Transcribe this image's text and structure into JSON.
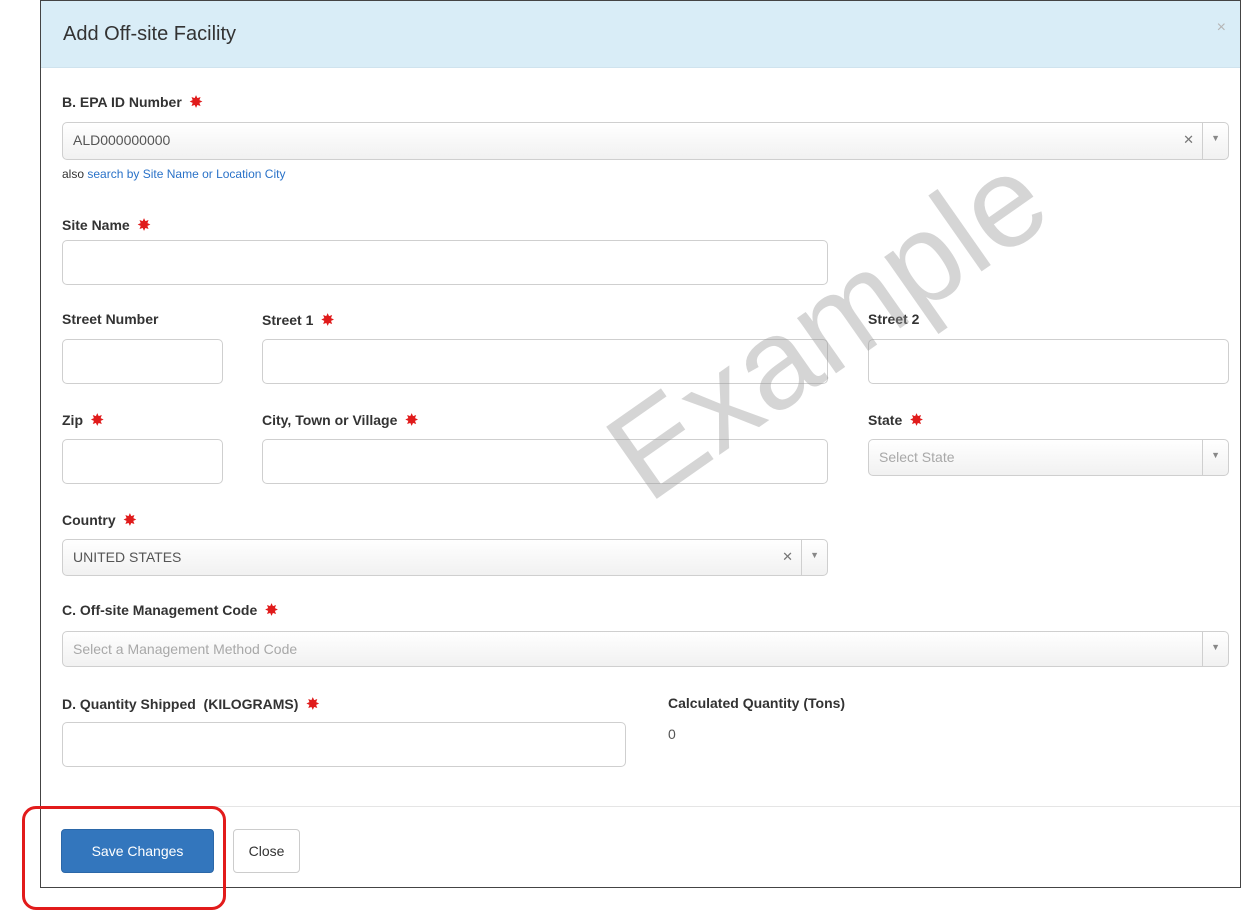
{
  "modal": {
    "title": "Add Off-site Facility",
    "close_glyph": "×"
  },
  "fields": {
    "epa_id": {
      "label": "B. EPA ID Number",
      "value": "ALD000000000",
      "helper_prefix": "also",
      "helper_link": "search by Site Name or Location City"
    },
    "site_name": {
      "label": "Site Name",
      "value": ""
    },
    "street_number": {
      "label": "Street Number",
      "value": ""
    },
    "street1": {
      "label": "Street 1",
      "value": ""
    },
    "street2": {
      "label": "Street 2",
      "value": ""
    },
    "zip": {
      "label": "Zip",
      "value": ""
    },
    "city": {
      "label": "City, Town or Village",
      "value": ""
    },
    "state": {
      "label": "State",
      "placeholder": "Select State"
    },
    "country": {
      "label": "Country",
      "value": "UNITED STATES"
    },
    "management_code": {
      "label": "C. Off-site Management Code",
      "placeholder": "Select a Management Method Code"
    },
    "quantity": {
      "label": "D. Quantity Shipped  (KILOGRAMS)",
      "value": ""
    },
    "calculated": {
      "label": "Calculated Quantity (Tons)",
      "value": "0"
    }
  },
  "required_marker": "✸",
  "footer": {
    "save_label": "Save Changes",
    "close_label": "Close"
  },
  "watermark": "Example",
  "colors": {
    "header_bg": "#d9edf7",
    "primary": "#3376bd",
    "required": "#e01b1b",
    "highlight": "#e21b1b",
    "link": "#2a72c8"
  }
}
